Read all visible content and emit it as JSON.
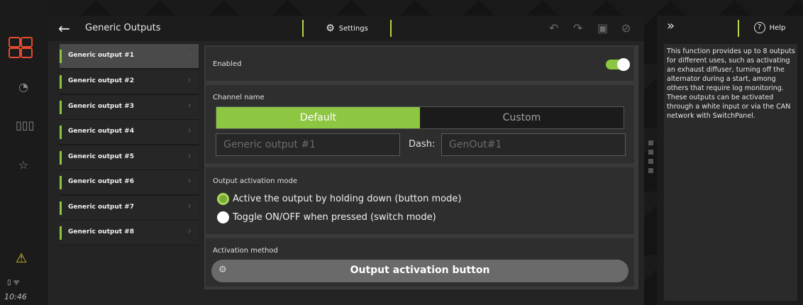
{
  "sidebar": {
    "time": "10:46"
  },
  "header": {
    "title": "Generic Outputs",
    "settings_tab": "Settings"
  },
  "list": {
    "items": [
      {
        "label": "Generic output #1"
      },
      {
        "label": "Generic output #2"
      },
      {
        "label": "Generic output #3"
      },
      {
        "label": "Generic output #4"
      },
      {
        "label": "Generic output #5"
      },
      {
        "label": "Generic output #6"
      },
      {
        "label": "Generic output #7"
      },
      {
        "label": "Generic output #8"
      }
    ],
    "selected_index": 0
  },
  "enabled": {
    "label": "Enabled",
    "value": true
  },
  "channel": {
    "label": "Channel name",
    "options": [
      "Default",
      "Custom"
    ],
    "selected": "Default",
    "name_value": "Generic output #1",
    "dash_label": "Dash:",
    "dash_value": "GenOut#1"
  },
  "mode": {
    "label": "Output activation mode",
    "options": [
      "Active the output by holding down (button mode)",
      "Toggle ON/OFF when pressed (switch mode)"
    ],
    "selected_index": 0
  },
  "activation": {
    "label": "Activation method",
    "button_label": "Output activation button"
  },
  "help": {
    "tab_label": "Help",
    "text": "This function provides up to 8 outputs for different uses, such as activating an exhaust diffuser, turning off the alternator during a start, among others that require log monitoring. These outputs can be activated through a white input or via the CAN network with SwitchPanel."
  },
  "colors": {
    "accent": "#8dc641",
    "warning": "#e6c52a",
    "logo": "#e64a2e"
  }
}
